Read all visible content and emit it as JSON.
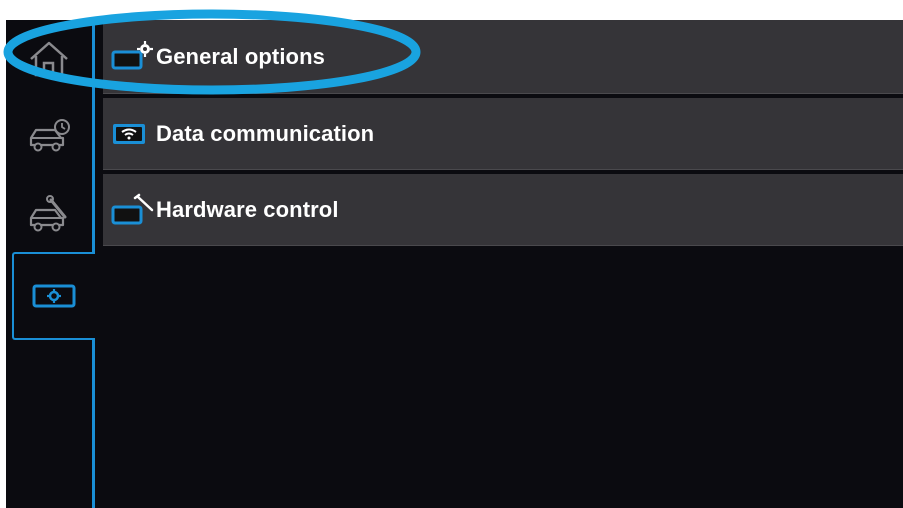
{
  "sidebar": {
    "items": [
      {
        "icon": "home-icon"
      },
      {
        "icon": "car-clock-icon"
      },
      {
        "icon": "car-wrench-icon"
      },
      {
        "icon": "settings-icon",
        "active": true
      }
    ]
  },
  "menu": {
    "items": [
      {
        "label": "General options",
        "icon": "general-options-icon"
      },
      {
        "label": "Data communication",
        "icon": "data-communication-icon"
      },
      {
        "label": "Hardware control",
        "icon": "hardware-control-icon"
      }
    ]
  },
  "colors": {
    "accent": "#1a8fd6",
    "background": "#0b0b10",
    "menu_item_bg": "#353438",
    "highlight_ring": "#19a3e0"
  }
}
